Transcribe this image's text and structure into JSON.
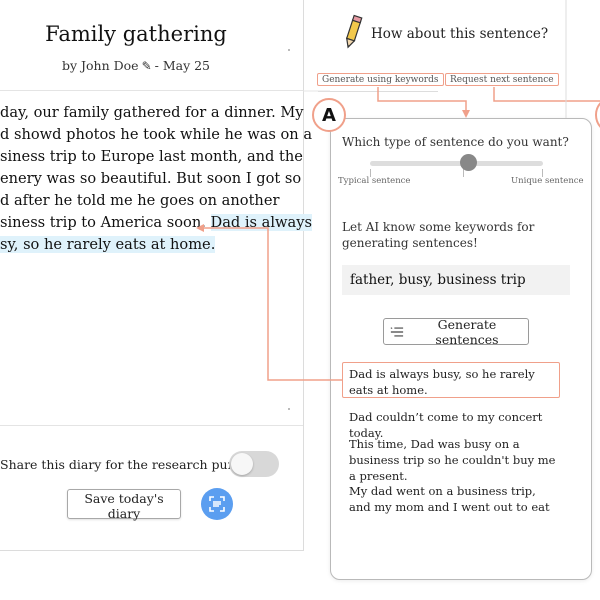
{
  "document": {
    "title": "Family gathering",
    "author_prefix": "by John Doe",
    "date_suffix": "- May 25",
    "diary_lines": [
      "day, our family gathered for a dinner. My",
      "d showd photos he took while he was on a",
      "siness trip to Europe last month, and the",
      "enery was so beautiful. But soon I got so",
      "d after he told me he goes on another"
    ],
    "line6_plain": "siness trip to America soon. ",
    "line6_highlight": "Dad is always",
    "line7_highlight": "sy, so he rarely eats at home.",
    "share_label": "Share this diary for the research purposes",
    "save_label": "Save today's diary"
  },
  "assistant": {
    "question": "How about this sentence?",
    "generate_keywords_label": "Generate using keywords",
    "request_next_label": "Request next sentence",
    "badge": "A",
    "type_question": "Which type of sentence do you want?",
    "slider_min_label": "Typical sentence",
    "slider_max_label": "Unique sentence",
    "slider_value": 0.57,
    "keywords_label": "Let AI know some keywords for generating sentences!",
    "keywords_value": "father, busy, business trip",
    "generate_label": "Generate sentences",
    "sentences": [
      "Dad is always busy, so he rarely eats at home.",
      "Dad couldn’t come to my concert today.",
      "This time, Dad was busy on a business trip so he couldn't buy me a present.",
      "My dad went on a business trip, and my mom and I went out to eat"
    ]
  },
  "colors": {
    "accent": "#f0a08a",
    "highlight": "#dff2fb",
    "fab": "#5b9ef0"
  },
  "icons": [
    "pencil-icon",
    "edit-pen-icon",
    "scan-icon",
    "list-generate-icon"
  ]
}
